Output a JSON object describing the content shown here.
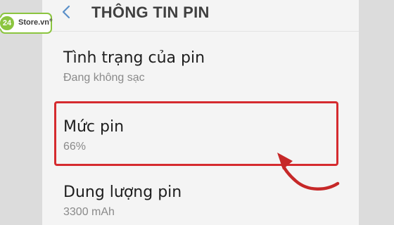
{
  "header": {
    "title": "THÔNG TIN PIN",
    "back_icon": "chevron-left-icon"
  },
  "items": [
    {
      "title": "Tình trạng của pin",
      "value": "Đang không sạc"
    },
    {
      "title": "Mức pin",
      "value": "66%"
    },
    {
      "title": "Dung lượng pin",
      "value": "3300 mAh"
    }
  ],
  "logo": {
    "number": "24",
    "text": "Store.vn",
    "registered": "®"
  },
  "colors": {
    "highlight": "#d52b2f",
    "brand_green": "#8bc53f",
    "back_icon": "#5a8fc8"
  }
}
